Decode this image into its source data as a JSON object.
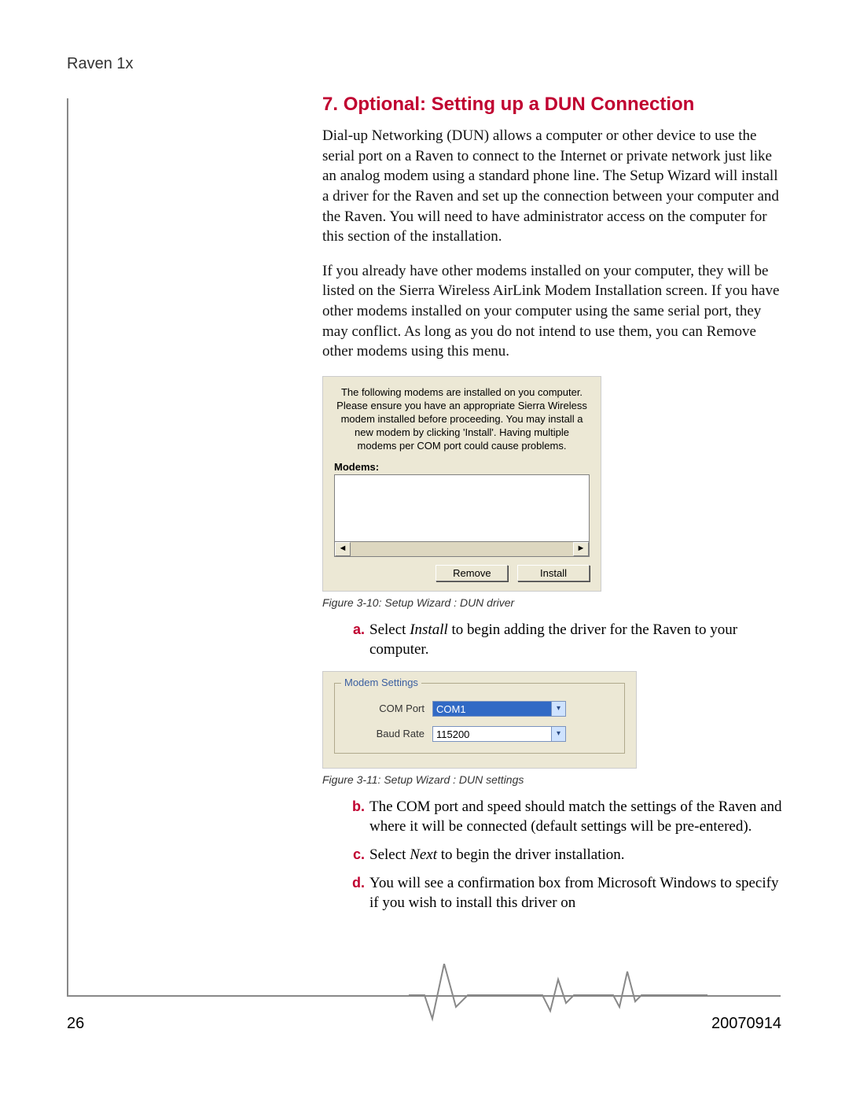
{
  "header": {
    "running_head": "Raven 1x"
  },
  "section": {
    "number": "7.",
    "title": "Optional: Setting up a DUN Connection"
  },
  "paragraphs": {
    "p1": "Dial-up Networking (DUN) allows a computer or other device to use the serial port on a Raven to connect to the Internet or private network just like an analog modem using a standard phone line. The Setup Wizard will install a driver for the Raven and set up the connection between your computer and the Raven. You will need to have administrator access on the computer for this section of the installation.",
    "p2": "If you already have other modems installed on your computer, they will be listed on the Sierra Wireless AirLink Modem Installation screen. If you have other modems installed on your computer using the same serial port, they may conflict. As long as you do not intend to use them, you can Remove other modems using this menu."
  },
  "figure_310": {
    "instruction": "The following modems are installed on you computer. Please ensure you have an appropriate Sierra Wireless modem installed before proceeding. You may install a new modem by clicking 'Install'. Having multiple modems per COM port could cause problems.",
    "modems_label": "Modems:",
    "buttons": {
      "remove": "Remove",
      "install": "Install"
    },
    "caption": "Figure 3-10: Setup Wizard : DUN driver"
  },
  "steps_top": {
    "a_letter": "a.",
    "a_pre": "Select ",
    "a_em": "Install",
    "a_post": " to begin adding the driver for the Raven to your computer."
  },
  "figure_311": {
    "legend": "Modem Settings",
    "com_port_label": "COM Port",
    "com_port_value": "COM1",
    "baud_rate_label": "Baud Rate",
    "baud_rate_value": "115200",
    "caption": "Figure 3-11: Setup Wizard : DUN settings"
  },
  "steps_bottom": {
    "b_letter": "b.",
    "b_text": "The COM port and speed should match the settings of the Raven and where it will be connected (default settings will be pre-entered).",
    "c_letter": "c.",
    "c_pre": "Select ",
    "c_em": "Next",
    "c_post": " to begin the driver installation.",
    "d_letter": "d.",
    "d_text": "You will see a confirmation box from Microsoft Windows to specify if you wish to install this driver on"
  },
  "footer": {
    "page": "26",
    "docid": "20070914"
  }
}
